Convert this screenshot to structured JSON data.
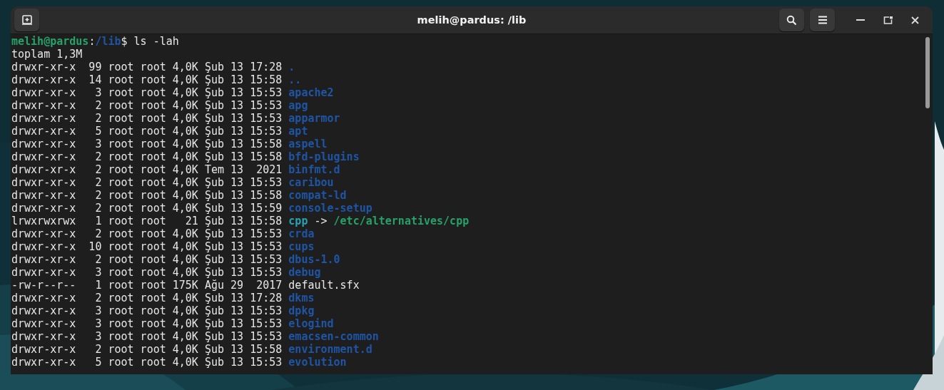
{
  "window": {
    "title": "melih@pardus: /lib"
  },
  "prompt": {
    "user_host": "melih@pardus",
    "separator": ":",
    "path": "/lib",
    "command": "$ ls -lah"
  },
  "summary": "toplam 1,3M",
  "entries": [
    {
      "kind": "dir",
      "info": "drwxr-xr-x  99 root root 4,0K Şub 13 17:28",
      "name": "."
    },
    {
      "kind": "dir",
      "info": "drwxr-xr-x  14 root root 4,0K Şub 13 15:58",
      "name": ".."
    },
    {
      "kind": "dir",
      "info": "drwxr-xr-x   3 root root 4,0K Şub 13 15:53",
      "name": "apache2"
    },
    {
      "kind": "dir",
      "info": "drwxr-xr-x   2 root root 4,0K Şub 13 15:53",
      "name": "apg"
    },
    {
      "kind": "dir",
      "info": "drwxr-xr-x   2 root root 4,0K Şub 13 15:53",
      "name": "apparmor"
    },
    {
      "kind": "dir",
      "info": "drwxr-xr-x   5 root root 4,0K Şub 13 15:53",
      "name": "apt"
    },
    {
      "kind": "dir",
      "info": "drwxr-xr-x   3 root root 4,0K Şub 13 15:58",
      "name": "aspell"
    },
    {
      "kind": "dir",
      "info": "drwxr-xr-x   2 root root 4,0K Şub 13 15:58",
      "name": "bfd-plugins"
    },
    {
      "kind": "dir",
      "info": "drwxr-xr-x   2 root root 4,0K Tem 13  2021",
      "name": "binfmt.d"
    },
    {
      "kind": "dir",
      "info": "drwxr-xr-x   2 root root 4,0K Şub 13 15:53",
      "name": "caribou"
    },
    {
      "kind": "dir",
      "info": "drwxr-xr-x   2 root root 4,0K Şub 13 15:58",
      "name": "compat-ld"
    },
    {
      "kind": "dir",
      "info": "drwxr-xr-x   2 root root 4,0K Şub 13 15:59",
      "name": "console-setup"
    },
    {
      "kind": "link",
      "info": "lrwxrwxrwx   1 root root   21 Şub 13 15:58",
      "name": "cpp",
      "arrow": "->",
      "target": "/etc/alternatives/cpp"
    },
    {
      "kind": "dir",
      "info": "drwxr-xr-x   2 root root 4,0K Şub 13 15:53",
      "name": "crda"
    },
    {
      "kind": "dir",
      "info": "drwxr-xr-x  10 root root 4,0K Şub 13 15:53",
      "name": "cups"
    },
    {
      "kind": "dir",
      "info": "drwxr-xr-x   2 root root 4,0K Şub 13 15:53",
      "name": "dbus-1.0"
    },
    {
      "kind": "dir",
      "info": "drwxr-xr-x   3 root root 4,0K Şub 13 15:53",
      "name": "debug"
    },
    {
      "kind": "file",
      "info": "-rw-r--r--   1 root root 175K Ağu 29  2017",
      "name": "default.sfx"
    },
    {
      "kind": "dir",
      "info": "drwxr-xr-x   2 root root 4,0K Şub 13 17:28",
      "name": "dkms"
    },
    {
      "kind": "dir",
      "info": "drwxr-xr-x   3 root root 4,0K Şub 13 15:53",
      "name": "dpkg"
    },
    {
      "kind": "dir",
      "info": "drwxr-xr-x   3 root root 4,0K Şub 13 15:53",
      "name": "elogind"
    },
    {
      "kind": "dir",
      "info": "drwxr-xr-x   3 root root 4,0K Şub 13 15:53",
      "name": "emacsen-common"
    },
    {
      "kind": "dir",
      "info": "drwxr-xr-x   2 root root 4,0K Şub 13 15:58",
      "name": "environment.d"
    },
    {
      "kind": "dir",
      "info": "drwxr-xr-x   5 root root 4,0K Şub 13 15:53",
      "name": "evolution"
    }
  ]
}
